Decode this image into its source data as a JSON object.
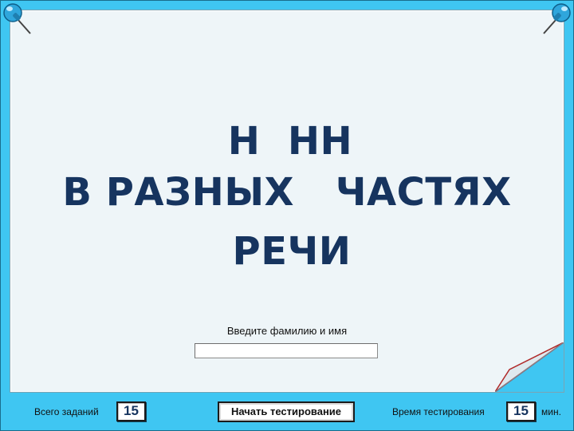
{
  "title": {
    "line1": "Н  НН",
    "line2": "В РАЗНЫХ   ЧАСТЯХ",
    "line3": "РЕЧИ"
  },
  "form": {
    "prompt": "Введите фамилию и имя",
    "name_value": ""
  },
  "footer": {
    "total_label": "Всего заданий",
    "total_value": "15",
    "start_label": "Начать тестирование",
    "time_label": "Время тестирования",
    "time_value": "15",
    "time_unit": "мин."
  },
  "colors": {
    "background": "#3fc6f2",
    "paper": "#eef5f8",
    "title_text": "#16345f",
    "pin": "#2fa6dc"
  },
  "icons": {
    "left_pin": "pushpin-icon",
    "right_pin": "pushpin-icon",
    "page_curl": "page-curl"
  }
}
